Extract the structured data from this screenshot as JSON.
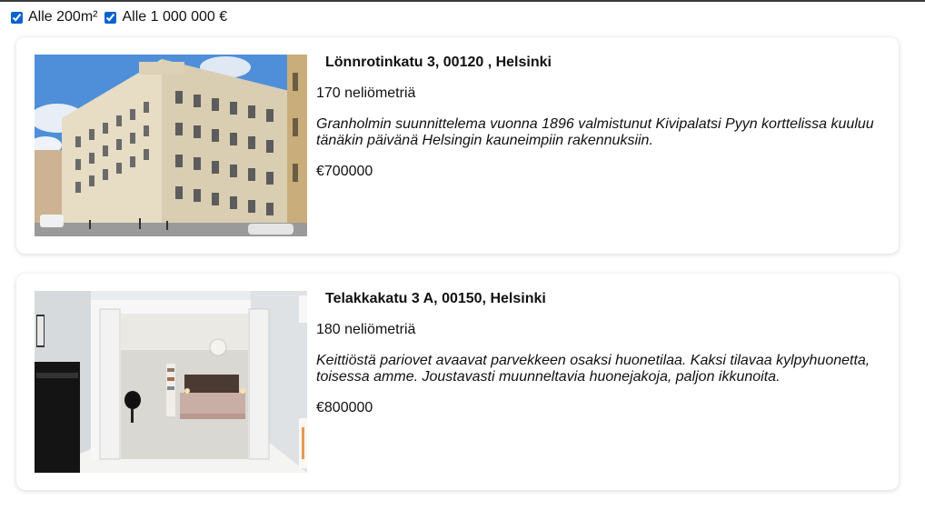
{
  "filters": [
    {
      "label": "Alle 200m²",
      "checked": true
    },
    {
      "label": "Alle 1 000 000 €",
      "checked": true
    }
  ],
  "listings": [
    {
      "address": "Lönnrotinkatu 3, 00120 , Helsinki",
      "size": "170 neliömetriä",
      "description": "Granholmin suunnittelema vuonna 1896 valmistunut Kivipalatsi Pyyn korttelissa kuuluu tänäkin päivänä Helsingin kauneimpiin rakennuksiin.",
      "price": "€700000",
      "photo": "building-exterior"
    },
    {
      "address": "Telakkakatu 3 A, 00150, Helsinki",
      "size": "180 neliömetriä",
      "description": "Keittiöstä pariovet avaavat parvekkeen osaksi huonetilaa. Kaksi tilavaa kylpyhuonetta, toisessa amme. Joustavasti muunneltavia huonejakoja, paljon ikkunoita.",
      "price": "€800000",
      "photo": "apartment-interior"
    }
  ]
}
